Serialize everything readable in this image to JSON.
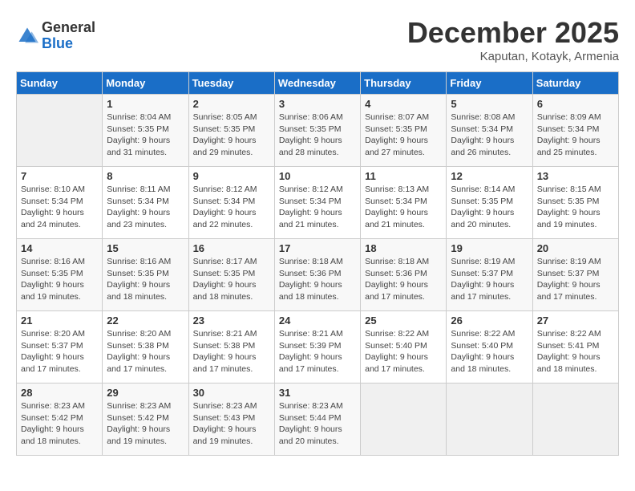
{
  "header": {
    "logo_general": "General",
    "logo_blue": "Blue",
    "month_title": "December 2025",
    "subtitle": "Kaputan, Kotayk, Armenia"
  },
  "days_of_week": [
    "Sunday",
    "Monday",
    "Tuesday",
    "Wednesday",
    "Thursday",
    "Friday",
    "Saturday"
  ],
  "weeks": [
    [
      {
        "day": "",
        "info": ""
      },
      {
        "day": "1",
        "info": "Sunrise: 8:04 AM\nSunset: 5:35 PM\nDaylight: 9 hours\nand 31 minutes."
      },
      {
        "day": "2",
        "info": "Sunrise: 8:05 AM\nSunset: 5:35 PM\nDaylight: 9 hours\nand 29 minutes."
      },
      {
        "day": "3",
        "info": "Sunrise: 8:06 AM\nSunset: 5:35 PM\nDaylight: 9 hours\nand 28 minutes."
      },
      {
        "day": "4",
        "info": "Sunrise: 8:07 AM\nSunset: 5:35 PM\nDaylight: 9 hours\nand 27 minutes."
      },
      {
        "day": "5",
        "info": "Sunrise: 8:08 AM\nSunset: 5:34 PM\nDaylight: 9 hours\nand 26 minutes."
      },
      {
        "day": "6",
        "info": "Sunrise: 8:09 AM\nSunset: 5:34 PM\nDaylight: 9 hours\nand 25 minutes."
      }
    ],
    [
      {
        "day": "7",
        "info": "Sunrise: 8:10 AM\nSunset: 5:34 PM\nDaylight: 9 hours\nand 24 minutes."
      },
      {
        "day": "8",
        "info": "Sunrise: 8:11 AM\nSunset: 5:34 PM\nDaylight: 9 hours\nand 23 minutes."
      },
      {
        "day": "9",
        "info": "Sunrise: 8:12 AM\nSunset: 5:34 PM\nDaylight: 9 hours\nand 22 minutes."
      },
      {
        "day": "10",
        "info": "Sunrise: 8:12 AM\nSunset: 5:34 PM\nDaylight: 9 hours\nand 21 minutes."
      },
      {
        "day": "11",
        "info": "Sunrise: 8:13 AM\nSunset: 5:34 PM\nDaylight: 9 hours\nand 21 minutes."
      },
      {
        "day": "12",
        "info": "Sunrise: 8:14 AM\nSunset: 5:35 PM\nDaylight: 9 hours\nand 20 minutes."
      },
      {
        "day": "13",
        "info": "Sunrise: 8:15 AM\nSunset: 5:35 PM\nDaylight: 9 hours\nand 19 minutes."
      }
    ],
    [
      {
        "day": "14",
        "info": "Sunrise: 8:16 AM\nSunset: 5:35 PM\nDaylight: 9 hours\nand 19 minutes."
      },
      {
        "day": "15",
        "info": "Sunrise: 8:16 AM\nSunset: 5:35 PM\nDaylight: 9 hours\nand 18 minutes."
      },
      {
        "day": "16",
        "info": "Sunrise: 8:17 AM\nSunset: 5:35 PM\nDaylight: 9 hours\nand 18 minutes."
      },
      {
        "day": "17",
        "info": "Sunrise: 8:18 AM\nSunset: 5:36 PM\nDaylight: 9 hours\nand 18 minutes."
      },
      {
        "day": "18",
        "info": "Sunrise: 8:18 AM\nSunset: 5:36 PM\nDaylight: 9 hours\nand 17 minutes."
      },
      {
        "day": "19",
        "info": "Sunrise: 8:19 AM\nSunset: 5:37 PM\nDaylight: 9 hours\nand 17 minutes."
      },
      {
        "day": "20",
        "info": "Sunrise: 8:19 AM\nSunset: 5:37 PM\nDaylight: 9 hours\nand 17 minutes."
      }
    ],
    [
      {
        "day": "21",
        "info": "Sunrise: 8:20 AM\nSunset: 5:37 PM\nDaylight: 9 hours\nand 17 minutes."
      },
      {
        "day": "22",
        "info": "Sunrise: 8:20 AM\nSunset: 5:38 PM\nDaylight: 9 hours\nand 17 minutes."
      },
      {
        "day": "23",
        "info": "Sunrise: 8:21 AM\nSunset: 5:38 PM\nDaylight: 9 hours\nand 17 minutes."
      },
      {
        "day": "24",
        "info": "Sunrise: 8:21 AM\nSunset: 5:39 PM\nDaylight: 9 hours\nand 17 minutes."
      },
      {
        "day": "25",
        "info": "Sunrise: 8:22 AM\nSunset: 5:40 PM\nDaylight: 9 hours\nand 17 minutes."
      },
      {
        "day": "26",
        "info": "Sunrise: 8:22 AM\nSunset: 5:40 PM\nDaylight: 9 hours\nand 18 minutes."
      },
      {
        "day": "27",
        "info": "Sunrise: 8:22 AM\nSunset: 5:41 PM\nDaylight: 9 hours\nand 18 minutes."
      }
    ],
    [
      {
        "day": "28",
        "info": "Sunrise: 8:23 AM\nSunset: 5:42 PM\nDaylight: 9 hours\nand 18 minutes."
      },
      {
        "day": "29",
        "info": "Sunrise: 8:23 AM\nSunset: 5:42 PM\nDaylight: 9 hours\nand 19 minutes."
      },
      {
        "day": "30",
        "info": "Sunrise: 8:23 AM\nSunset: 5:43 PM\nDaylight: 9 hours\nand 19 minutes."
      },
      {
        "day": "31",
        "info": "Sunrise: 8:23 AM\nSunset: 5:44 PM\nDaylight: 9 hours\nand 20 minutes."
      },
      {
        "day": "",
        "info": ""
      },
      {
        "day": "",
        "info": ""
      },
      {
        "day": "",
        "info": ""
      }
    ]
  ]
}
